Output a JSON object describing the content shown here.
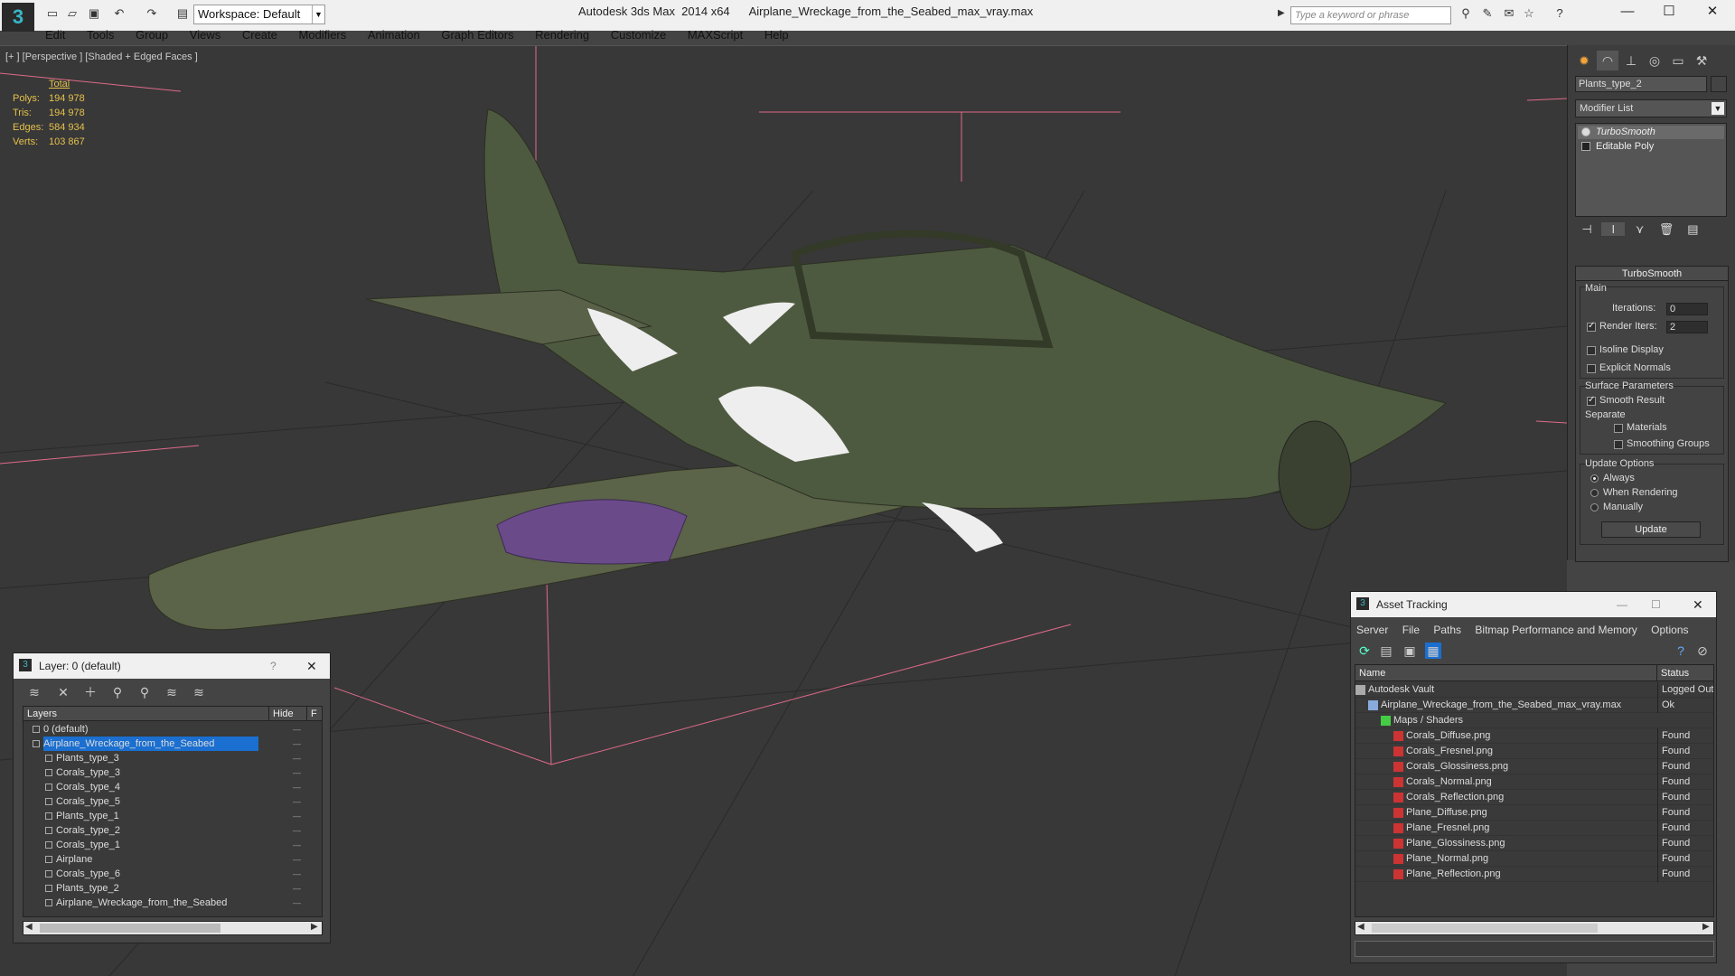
{
  "titlebar": {
    "workspace": "Workspace: Default",
    "title": "Autodesk 3ds Max  2014 x64      Airplane_Wreckage_from_the_Seabed_max_vray.max",
    "search_placeholder": "Type a keyword or phrase"
  },
  "menu": [
    "Edit",
    "Tools",
    "Group",
    "Views",
    "Create",
    "Modifiers",
    "Animation",
    "Graph Editors",
    "Rendering",
    "Customize",
    "MAXScript",
    "Help"
  ],
  "viewport": {
    "label": "[+ ] [Perspective ] [Shaded + Edged Faces ]",
    "stats_header": "Total",
    "stats": [
      {
        "k": "Polys:",
        "v": "194 978"
      },
      {
        "k": "Tris:",
        "v": "194 978"
      },
      {
        "k": "Edges:",
        "v": "584 934"
      },
      {
        "k": "Verts:",
        "v": "103 867"
      }
    ]
  },
  "command_panel": {
    "object_name": "Plants_type_2",
    "modifier_list": "Modifier List",
    "stack": [
      "TurboSmooth",
      "Editable Poly"
    ],
    "rollout": "TurboSmooth",
    "main": "Main",
    "iterations_label": "Iterations:",
    "iterations": "0",
    "render_iters_label": "Render Iters:",
    "render_iters": "2",
    "isoline": "Isoline Display",
    "explicit_normals": "Explicit Normals",
    "surface_params": "Surface Parameters",
    "smooth_result": "Smooth Result",
    "separate": "Separate",
    "materials": "Materials",
    "smoothing_groups": "Smoothing Groups",
    "update_options": "Update Options",
    "always": "Always",
    "when_rendering": "When Rendering",
    "manually": "Manually",
    "update": "Update"
  },
  "layer_window": {
    "title": "Layer: 0 (default)",
    "help": "?",
    "col_layers": "Layers",
    "col_hide": "Hide",
    "col_f": "F",
    "rows": [
      {
        "name": "0 (default)",
        "indent": 0
      },
      {
        "name": "Airplane_Wreckage_from_the_Seabed",
        "indent": 0,
        "selected": true
      },
      {
        "name": "Plants_type_3",
        "indent": 1
      },
      {
        "name": "Corals_type_3",
        "indent": 1
      },
      {
        "name": "Corals_type_4",
        "indent": 1
      },
      {
        "name": "Corals_type_5",
        "indent": 1
      },
      {
        "name": "Plants_type_1",
        "indent": 1
      },
      {
        "name": "Corals_type_2",
        "indent": 1
      },
      {
        "name": "Corals_type_1",
        "indent": 1
      },
      {
        "name": "Airplane",
        "indent": 1
      },
      {
        "name": "Corals_type_6",
        "indent": 1
      },
      {
        "name": "Plants_type_2",
        "indent": 1
      },
      {
        "name": "Airplane_Wreckage_from_the_Seabed",
        "indent": 1
      }
    ]
  },
  "asset_tracking": {
    "title": "Asset Tracking",
    "menu": [
      "Server",
      "File",
      "Paths",
      "Bitmap Performance and Memory",
      "Options"
    ],
    "col_name": "Name",
    "col_status": "Status",
    "rows": [
      {
        "name": "Autodesk Vault",
        "status": "Logged Out",
        "indent": 0
      },
      {
        "name": "Airplane_Wreckage_from_the_Seabed_max_vray.max",
        "status": "Ok",
        "indent": 1
      },
      {
        "name": "Maps / Shaders",
        "status": "",
        "indent": 2
      },
      {
        "name": "Corals_Diffuse.png",
        "status": "Found",
        "indent": 3
      },
      {
        "name": "Corals_Fresnel.png",
        "status": "Found",
        "indent": 3
      },
      {
        "name": "Corals_Glossiness.png",
        "status": "Found",
        "indent": 3
      },
      {
        "name": "Corals_Normal.png",
        "status": "Found",
        "indent": 3
      },
      {
        "name": "Corals_Reflection.png",
        "status": "Found",
        "indent": 3
      },
      {
        "name": "Plane_Diffuse.png",
        "status": "Found",
        "indent": 3
      },
      {
        "name": "Plane_Fresnel.png",
        "status": "Found",
        "indent": 3
      },
      {
        "name": "Plane_Glossiness.png",
        "status": "Found",
        "indent": 3
      },
      {
        "name": "Plane_Normal.png",
        "status": "Found",
        "indent": 3
      },
      {
        "name": "Plane_Reflection.png",
        "status": "Found",
        "indent": 3
      }
    ]
  },
  "colors": {
    "viewport_bg": "#383838",
    "stats": "#e5c04b",
    "selection": "#1a6fd0",
    "gizmo": "#e06a8a"
  }
}
